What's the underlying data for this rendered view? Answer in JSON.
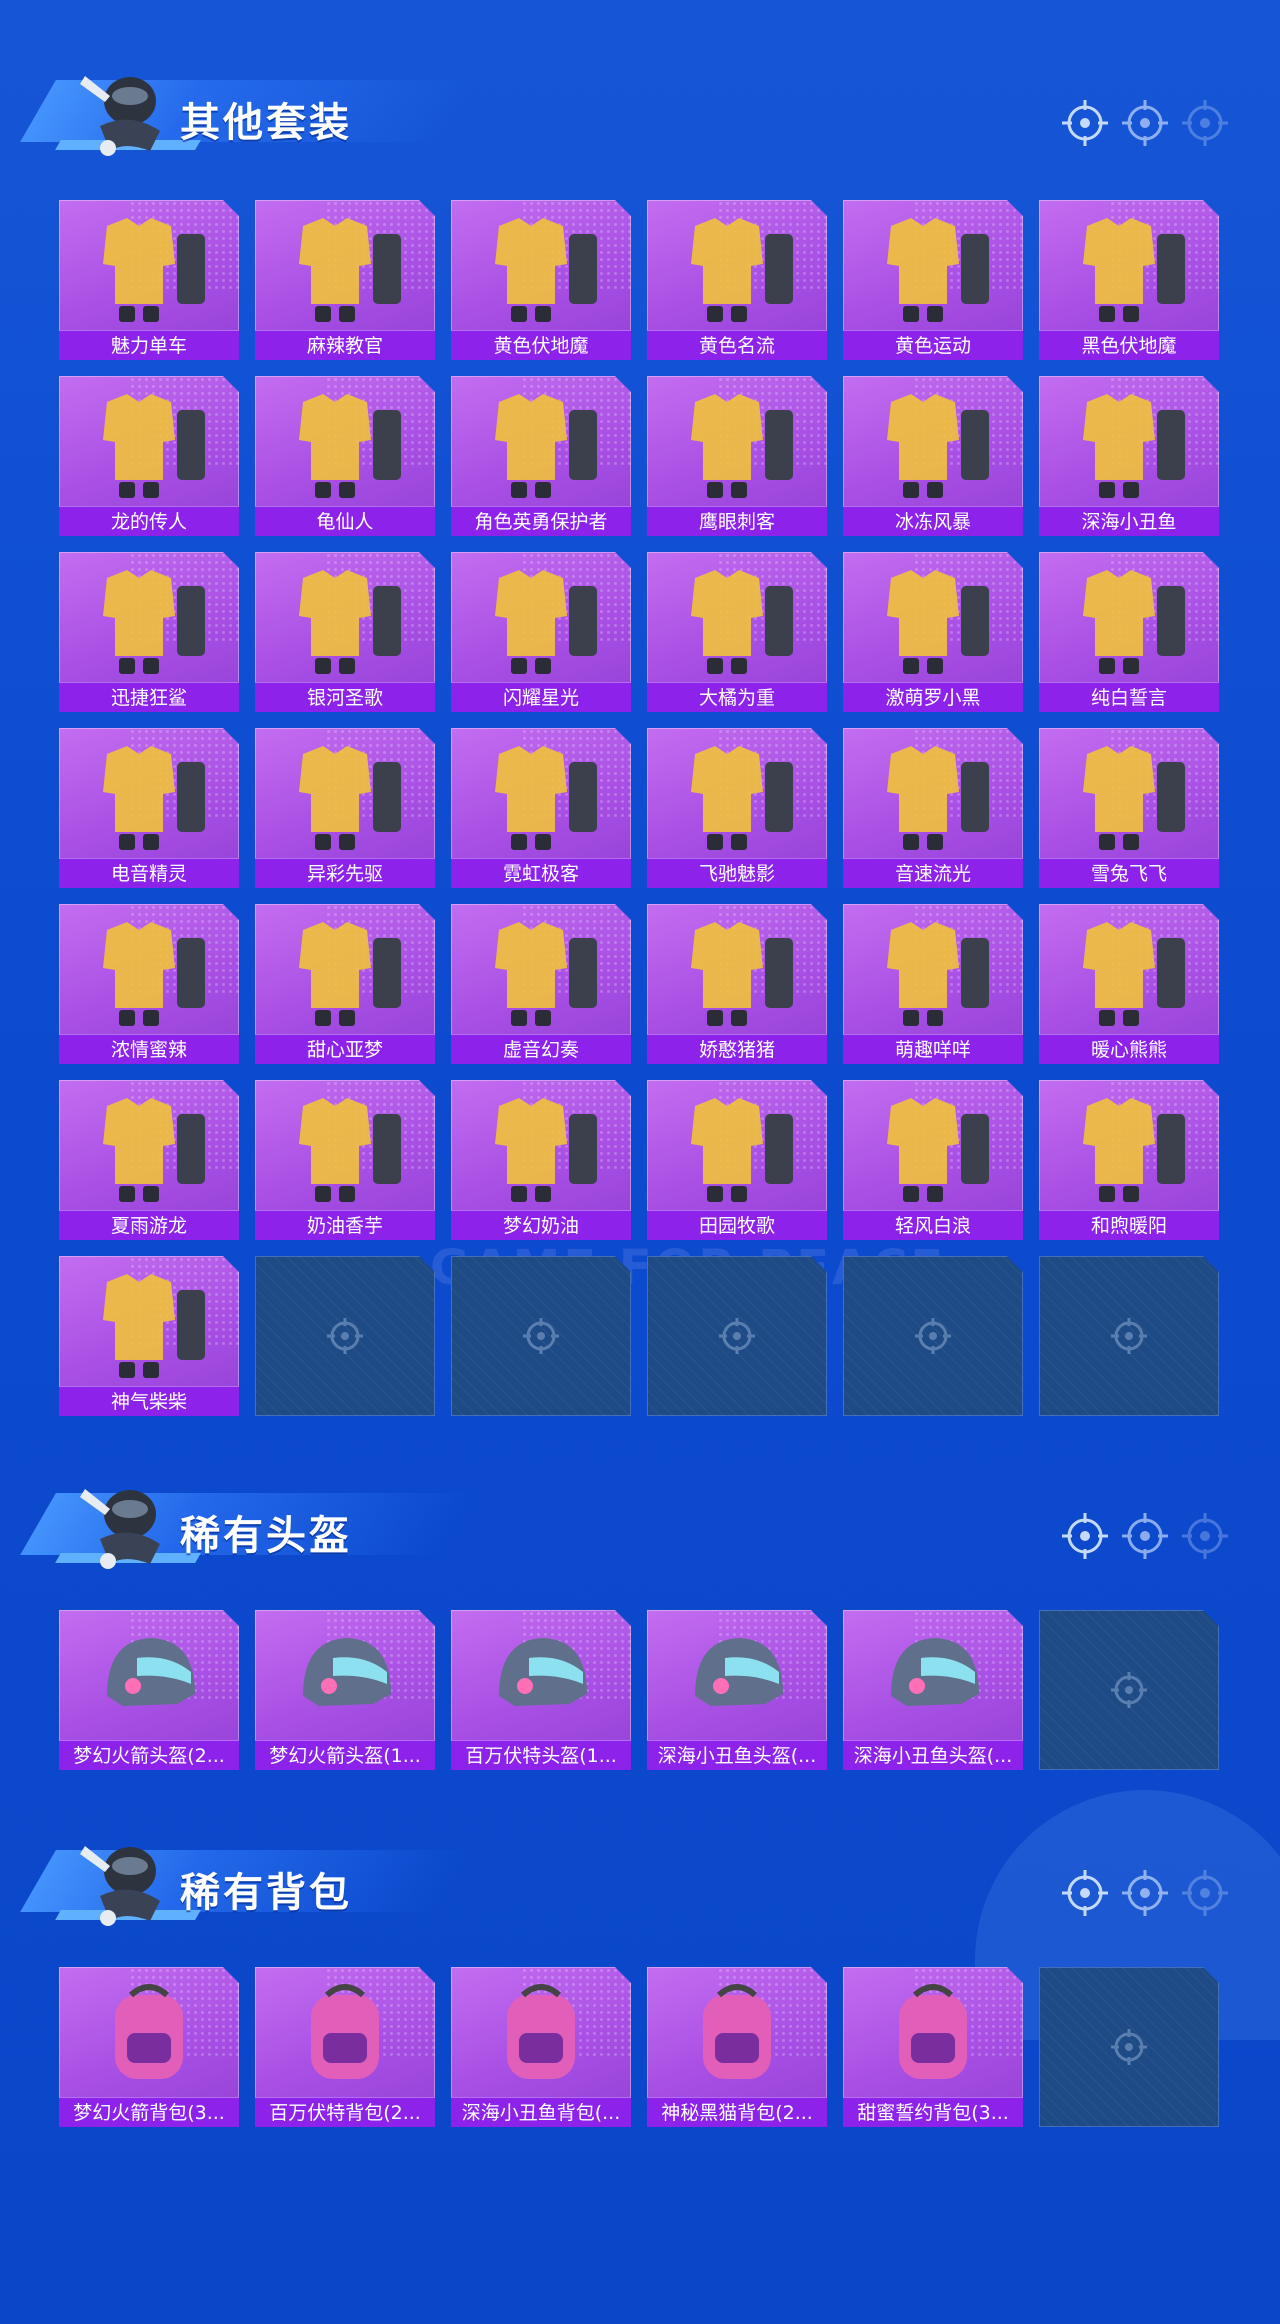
{
  "colors": {
    "background": "#0d4bd0",
    "card": "#b05ae8",
    "card_label": "#8d22ea",
    "empty_slot": "#1e4a85"
  },
  "sections": [
    {
      "title": "其他套装",
      "items": [
        "魅力单车",
        "麻辣教官",
        "黄色伏地魔",
        "黄色名流",
        "黄色运动",
        "黑色伏地魔",
        "龙的传人",
        "龟仙人",
        "角色英勇保护者",
        "鹰眼刺客",
        "冰冻风暴",
        "深海小丑鱼",
        "迅捷狂鲨",
        "银河圣歌",
        "闪耀星光",
        "大橘为重",
        "激萌罗小黑",
        "纯白誓言",
        "电音精灵",
        "异彩先驱",
        "霓虹极客",
        "飞驰魅影",
        "音速流光",
        "雪兔飞飞",
        "浓情蜜辣",
        "甜心亚梦",
        "虚音幻奏",
        "娇憨猪猪",
        "萌趣咩咩",
        "暖心熊熊",
        "夏雨游龙",
        "奶油香芋",
        "梦幻奶油",
        "田园牧歌",
        "轻风白浪",
        "和煦暖阳",
        "神气柴柴"
      ]
    },
    {
      "title": "稀有头盔",
      "items": [
        "梦幻火箭头盔(2...",
        "梦幻火箭头盔(1...",
        "百万伏特头盔(1...",
        "深海小丑鱼头盔(...",
        "深海小丑鱼头盔(..."
      ]
    },
    {
      "title": "稀有背包",
      "items": [
        "梦幻火箭背包(3...",
        "百万伏特背包(2...",
        "深海小丑鱼背包(...",
        "神秘黑猫背包(2...",
        "甜蜜誓约背包(3..."
      ]
    }
  ],
  "watermark": "GAME FOR PEACE",
  "icons": {
    "section_mascot": "soldier-mascot-icon",
    "crosshair": "crosshair-icon"
  }
}
